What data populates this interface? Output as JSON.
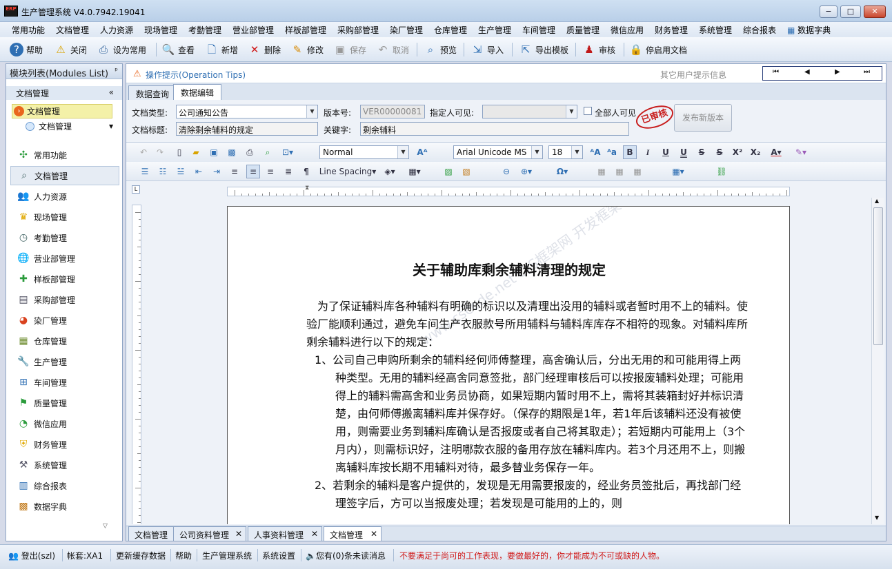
{
  "app": {
    "logo": "ERP",
    "title": "生产管理系统 V4.0.7942.19041"
  },
  "window": {
    "min": "−",
    "max": "□",
    "close": "✕"
  },
  "menu": [
    "常用功能",
    "文档管理",
    "人力资源",
    "现场管理",
    "考勤管理",
    "营业部管理",
    "样板部管理",
    "采购部管理",
    "染厂管理",
    "仓库管理",
    "生产管理",
    "车间管理",
    "质量管理",
    "微信应用",
    "财务管理",
    "系统管理",
    "综合报表",
    "数据字典"
  ],
  "toolbar": {
    "help": "帮助",
    "close": "关闭",
    "set_common": "设为常用",
    "view": "查看",
    "add": "新增",
    "delete": "删除",
    "edit": "修改",
    "save": "保存",
    "cancel": "取消",
    "preview": "预览",
    "import": "导入",
    "export_template": "导出模板",
    "audit": "审核",
    "toggle_doc": "停启用文档"
  },
  "left": {
    "title": "模块列表(Modules List)",
    "pin": "ᵖ",
    "section": "文档管理",
    "collapse": "«",
    "tree_selected": "文档管理",
    "tree_child": "文档管理",
    "nav": [
      "常用功能",
      "文档管理",
      "人力资源",
      "现场管理",
      "考勤管理",
      "营业部管理",
      "样板部管理",
      "采购部管理",
      "染厂管理",
      "仓库管理",
      "生产管理",
      "车间管理",
      "质量管理",
      "微信应用",
      "财务管理",
      "系统管理",
      "综合报表",
      "数据字典"
    ]
  },
  "tips": {
    "label": "操作提示(Operation Tips)",
    "other": "其它用户提示信息",
    "nav_first": "⏮",
    "nav_prev": "◀",
    "nav_next": "▶",
    "nav_last": "⏭"
  },
  "tabs": [
    "数据查询",
    "数据编辑"
  ],
  "form": {
    "doc_type_label": "文档类型:",
    "doc_type": "公司通知公告",
    "version_label": "版本号:",
    "version": "VER00000081",
    "visible_label": "指定人可见:",
    "visible": "",
    "all_visible": "全部人可见",
    "title_label": "文档标题:",
    "title": "清除剩余辅料的规定",
    "keyword_label": "关键字:",
    "keyword": "剩余辅料",
    "publish": "发布新版本",
    "stamp": "已审核"
  },
  "editor": {
    "style": "Normal",
    "font": "Arial Unicode MS",
    "size": "18",
    "line_spacing": "Line Spacing"
  },
  "doc": {
    "title": "关于辅助库剩余辅料清理的规定",
    "p1": "为了保证辅料库各种辅料有明确的标识以及清理出没用的辅料或者暂时用不上的辅料。使验厂能顺利通过，避免车间生产衣服款号所用辅料与辅料库库存不相符的现象。对辅料库所剩余辅料进行以下的规定：",
    "i1": "1、公司自己申购所剩余的辅料经何师傅整理，高舍确认后，分出无用的和可能用得上两种类型。无用的辅料经高舍同意签批，部门经理审核后可以按报废辅料处理；可能用得上的辅料需高舍和业务员协商，如果短期内暂时用不上，需将其装箱封好并标识清楚，由何师傅搬离辅料库并保存好。（保存的期限是1年，若1年后该辅料还没有被使用，则需要业务到辅料库确认是否报废或者自己将其取走）；若短期内可能用上（3个月内），则需标识好，注明哪款衣服的备用存放在辅料库内。若3个月还用不上，则搬离辅料库按长期不用辅料对待，最多替业务保存一年。",
    "i2": "2、若剩余的辅料是客户提供的，发现是无用需要报废的，经业务员签批后，再找部门经理签字后，方可以当报废处理；若发现是可能用的上的，则",
    "watermark": "www.cscode.net C/S框架网 开发框架"
  },
  "doctabs": [
    "文档管理",
    "公司资料管理",
    "人事资料管理",
    "文档管理"
  ],
  "status": {
    "logout": "登出(szl)",
    "account": "帐套:XA1",
    "refresh": "更新缓存数据",
    "help": "帮助",
    "system": "生产管理系统",
    "settings": "系统设置",
    "messages": "您有(0)条未读消息",
    "motto": "不要满足于尚可的工作表现，要做最好的，你才能成为不可或缺的人物。"
  }
}
